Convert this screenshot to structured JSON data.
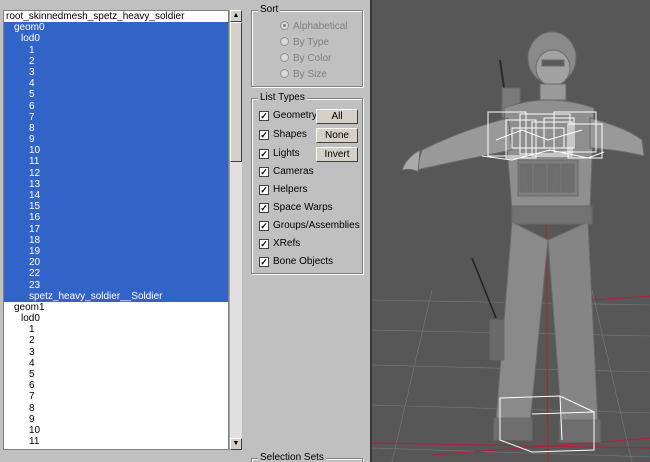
{
  "tree": {
    "rows": [
      {
        "text": "root_skinnedmesh_spetz_heavy_soldier",
        "depth": 0,
        "selected": false
      },
      {
        "text": "geom0",
        "depth": 1,
        "selected": true
      },
      {
        "text": "lod0",
        "depth": 2,
        "selected": true
      },
      {
        "text": "1",
        "depth": 3,
        "selected": true
      },
      {
        "text": "2",
        "depth": 3,
        "selected": true
      },
      {
        "text": "3",
        "depth": 3,
        "selected": true
      },
      {
        "text": "4",
        "depth": 3,
        "selected": true
      },
      {
        "text": "5",
        "depth": 3,
        "selected": true
      },
      {
        "text": "6",
        "depth": 3,
        "selected": true
      },
      {
        "text": "7",
        "depth": 3,
        "selected": true
      },
      {
        "text": "8",
        "depth": 3,
        "selected": true
      },
      {
        "text": "9",
        "depth": 3,
        "selected": true
      },
      {
        "text": "10",
        "depth": 3,
        "selected": true
      },
      {
        "text": "11",
        "depth": 3,
        "selected": true
      },
      {
        "text": "12",
        "depth": 3,
        "selected": true
      },
      {
        "text": "13",
        "depth": 3,
        "selected": true
      },
      {
        "text": "14",
        "depth": 3,
        "selected": true
      },
      {
        "text": "15",
        "depth": 3,
        "selected": true
      },
      {
        "text": "16",
        "depth": 3,
        "selected": true
      },
      {
        "text": "17",
        "depth": 3,
        "selected": true
      },
      {
        "text": "18",
        "depth": 3,
        "selected": true
      },
      {
        "text": "19",
        "depth": 3,
        "selected": true
      },
      {
        "text": "20",
        "depth": 3,
        "selected": true
      },
      {
        "text": "22",
        "depth": 3,
        "selected": true
      },
      {
        "text": "23",
        "depth": 3,
        "selected": true
      },
      {
        "text": "spetz_heavy_soldier__Soldier",
        "depth": 3,
        "selected": true
      },
      {
        "text": "geom1",
        "depth": 1,
        "selected": false
      },
      {
        "text": "lod0",
        "depth": 2,
        "selected": false
      },
      {
        "text": "1",
        "depth": 3,
        "selected": false
      },
      {
        "text": "2",
        "depth": 3,
        "selected": false
      },
      {
        "text": "3",
        "depth": 3,
        "selected": false
      },
      {
        "text": "4",
        "depth": 3,
        "selected": false
      },
      {
        "text": "5",
        "depth": 3,
        "selected": false
      },
      {
        "text": "6",
        "depth": 3,
        "selected": false
      },
      {
        "text": "7",
        "depth": 3,
        "selected": false
      },
      {
        "text": "8",
        "depth": 3,
        "selected": false
      },
      {
        "text": "9",
        "depth": 3,
        "selected": false
      },
      {
        "text": "10",
        "depth": 3,
        "selected": false
      },
      {
        "text": "11",
        "depth": 3,
        "selected": false
      }
    ]
  },
  "sort": {
    "title": "Sort",
    "options": [
      {
        "label": "Alphabetical",
        "selected": true
      },
      {
        "label": "By Type",
        "selected": false
      },
      {
        "label": "By Color",
        "selected": false
      },
      {
        "label": "By Size",
        "selected": false
      }
    ]
  },
  "list_types": {
    "title": "List Types",
    "items": [
      {
        "label": "Geometry",
        "checked": true
      },
      {
        "label": "Shapes",
        "checked": true
      },
      {
        "label": "Lights",
        "checked": true
      },
      {
        "label": "Cameras",
        "checked": true
      },
      {
        "label": "Helpers",
        "checked": true
      },
      {
        "label": "Space Warps",
        "checked": true
      },
      {
        "label": "Groups/Assemblies",
        "checked": true
      },
      {
        "label": "XRefs",
        "checked": true
      },
      {
        "label": "Bone Objects",
        "checked": true
      }
    ],
    "buttons": {
      "all": "All",
      "none": "None",
      "invert": "Invert"
    }
  },
  "selection_sets": {
    "title": "Selection Sets"
  },
  "colors": {
    "selection": "#3264c8",
    "viewport_bg": "#575757",
    "grid_red": "#b0203a"
  }
}
